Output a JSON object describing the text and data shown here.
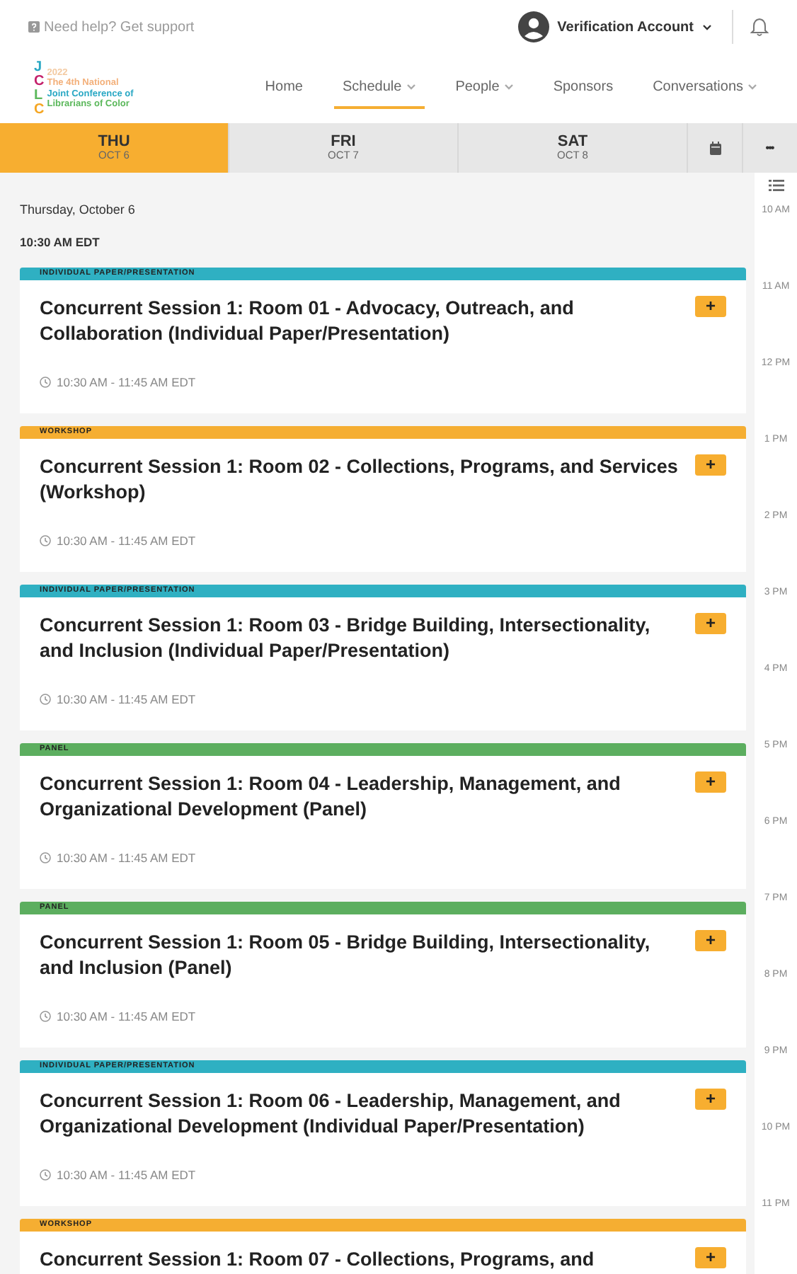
{
  "top_bar": {
    "help": "Need help? Get support",
    "account": "Verification Account"
  },
  "logo": {
    "letters": [
      {
        "text": "J",
        "color": "#2aa8c4"
      },
      {
        "text": "C",
        "color": "#c4216b"
      },
      {
        "text": "L",
        "color": "#5cb85c"
      },
      {
        "text": "C",
        "color": "#f5a623"
      }
    ],
    "year": "2022",
    "lines": [
      "The 4th National",
      "Joint Conference of",
      "Librarians of Color"
    ]
  },
  "nav": [
    {
      "label": "Home",
      "dropdown": false,
      "selected": false
    },
    {
      "label": "Schedule",
      "dropdown": true,
      "selected": true
    },
    {
      "label": "People",
      "dropdown": true,
      "selected": false
    },
    {
      "label": "Sponsors",
      "dropdown": false,
      "selected": false
    },
    {
      "label": "Conversations",
      "dropdown": true,
      "selected": false
    }
  ],
  "days": [
    {
      "day": "THU",
      "date": "OCT 6",
      "selected": true
    },
    {
      "day": "FRI",
      "date": "OCT 7",
      "selected": false
    },
    {
      "day": "SAT",
      "date": "OCT 8",
      "selected": false
    }
  ],
  "date_heading": "Thursday, October 6",
  "time_heading": "10:30 AM EDT",
  "sessions": [
    {
      "tag": "INDIVIDUAL PAPER/PRESENTATION",
      "color": "#2fb0c2",
      "title": "Concurrent Session 1: Room 01 - Advocacy, Outreach, and Collaboration (Individual Paper/Presentation)",
      "time": "10:30 AM - 11:45 AM EDT"
    },
    {
      "tag": "WORKSHOP",
      "color": "#f5ae32",
      "title": "Concurrent Session 1: Room 02 - Collections, Programs, and Services (Workshop)",
      "time": "10:30 AM - 11:45 AM EDT"
    },
    {
      "tag": "INDIVIDUAL PAPER/PRESENTATION",
      "color": "#2fb0c2",
      "title": "Concurrent Session 1: Room 03 - Bridge Building, Intersectionality, and Inclusion (Individual Paper/Presentation)",
      "time": "10:30 AM - 11:45 AM EDT"
    },
    {
      "tag": "PANEL",
      "color": "#5cae5f",
      "title": "Concurrent Session 1: Room 04 - Leadership, Management, and Organizational Development (Panel)",
      "time": "10:30 AM - 11:45 AM EDT"
    },
    {
      "tag": "PANEL",
      "color": "#5cae5f",
      "title": "Concurrent Session 1: Room 05 - Bridge Building, Intersectionality, and Inclusion (Panel)",
      "time": "10:30 AM - 11:45 AM EDT"
    },
    {
      "tag": "INDIVIDUAL PAPER/PRESENTATION",
      "color": "#2fb0c2",
      "title": "Concurrent Session 1: Room 06 - Leadership, Management, and Organizational Development (Individual Paper/Presentation)",
      "time": "10:30 AM - 11:45 AM EDT"
    },
    {
      "tag": "WORKSHOP",
      "color": "#f5ae32",
      "title": "Concurrent Session 1: Room 07 - Collections, Programs, and"
    }
  ],
  "add_label": "+",
  "more_label": "•••",
  "timeline": [
    "10 AM",
    "11 AM",
    "12 PM",
    "1 PM",
    "2 PM",
    "3 PM",
    "4 PM",
    "5 PM",
    "6 PM",
    "7 PM",
    "8 PM",
    "9 PM",
    "10 PM",
    "11 PM"
  ]
}
